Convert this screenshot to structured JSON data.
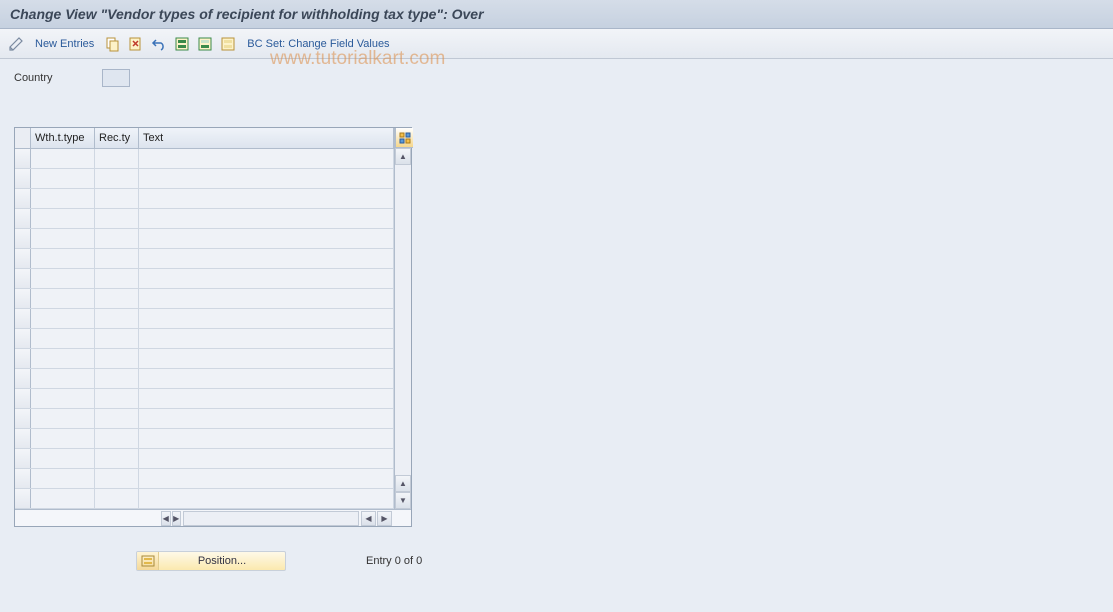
{
  "title": "Change View \"Vendor types of recipient for withholding tax type\": Over",
  "toolbar": {
    "new_entries_label": "New Entries",
    "bc_set_label": "BC Set: Change Field Values"
  },
  "fields": {
    "country_label": "Country",
    "country_value": ""
  },
  "table": {
    "headers": {
      "wth_type": "Wth.t.type",
      "rec_ty": "Rec.ty",
      "text": "Text"
    },
    "rows": [
      {
        "wth_type": "",
        "rec_ty": "",
        "text": ""
      },
      {
        "wth_type": "",
        "rec_ty": "",
        "text": ""
      },
      {
        "wth_type": "",
        "rec_ty": "",
        "text": ""
      },
      {
        "wth_type": "",
        "rec_ty": "",
        "text": ""
      },
      {
        "wth_type": "",
        "rec_ty": "",
        "text": ""
      },
      {
        "wth_type": "",
        "rec_ty": "",
        "text": ""
      },
      {
        "wth_type": "",
        "rec_ty": "",
        "text": ""
      },
      {
        "wth_type": "",
        "rec_ty": "",
        "text": ""
      },
      {
        "wth_type": "",
        "rec_ty": "",
        "text": ""
      },
      {
        "wth_type": "",
        "rec_ty": "",
        "text": ""
      },
      {
        "wth_type": "",
        "rec_ty": "",
        "text": ""
      },
      {
        "wth_type": "",
        "rec_ty": "",
        "text": ""
      },
      {
        "wth_type": "",
        "rec_ty": "",
        "text": ""
      },
      {
        "wth_type": "",
        "rec_ty": "",
        "text": ""
      },
      {
        "wth_type": "",
        "rec_ty": "",
        "text": ""
      },
      {
        "wth_type": "",
        "rec_ty": "",
        "text": ""
      },
      {
        "wth_type": "",
        "rec_ty": "",
        "text": ""
      },
      {
        "wth_type": "",
        "rec_ty": "",
        "text": ""
      }
    ]
  },
  "footer": {
    "position_label": "Position...",
    "entry_count": "Entry 0 of 0"
  },
  "watermark": "www.tutorialkart.com"
}
